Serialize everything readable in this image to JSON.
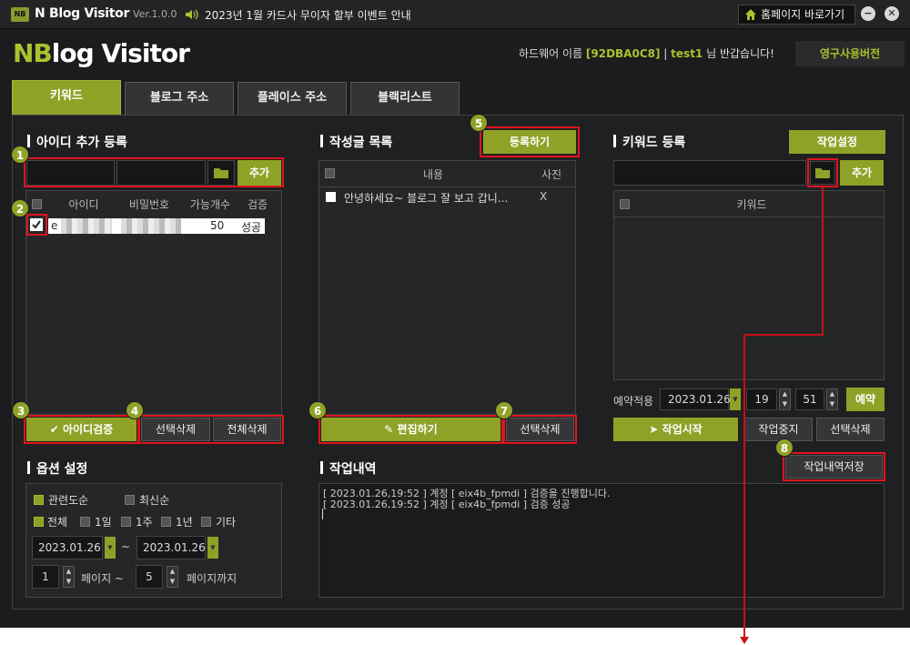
{
  "titlebar": {
    "logo_badge": "NB",
    "title": "N Blog Visitor",
    "version": "Ver.1.0.0",
    "notice": "2023년 1월 카드사 무이자 할부 이벤트 안내",
    "home_button": "홈페이지 바로가기",
    "minimize": "−",
    "close": "✕"
  },
  "header": {
    "logo_prefix": "NB",
    "logo_rest": "log Visitor",
    "greeting_prefix": "하드웨어 이름",
    "hardware_id": "[92DBA0C8]",
    "separator": "|",
    "username": "test1",
    "greeting_suffix": "님 반갑습니다!",
    "license": "영구사용버전"
  },
  "tabs": [
    {
      "label": "키워드"
    },
    {
      "label": "블로그 주소"
    },
    {
      "label": "플레이스 주소"
    },
    {
      "label": "블랙리스트"
    }
  ],
  "accounts": {
    "title": "아이디 추가 등록",
    "add_button": "추가",
    "columns": [
      "아이디",
      "비밀번호",
      "가능개수",
      "검증"
    ],
    "rows": [
      {
        "id_prefix": "e",
        "count": "50",
        "status": "성공"
      }
    ],
    "verify_button": "아이디검증",
    "delete_selected": "선택삭제",
    "delete_all": "전체삭제"
  },
  "posts": {
    "title": "작성글 목록",
    "register_button": "등록하기",
    "columns": [
      "내용",
      "사진"
    ],
    "rows": [
      {
        "content": "안녕하세요~ 블로그 잘 보고 갑니...",
        "photo": "X"
      }
    ],
    "edit_button": "편집하기",
    "delete_selected": "선택삭제"
  },
  "keywords": {
    "title": "키워드 등록",
    "settings_button": "작업설정",
    "add_button": "추가",
    "column": "키워드",
    "schedule_label": "예약적용",
    "date": "2023.01.26",
    "hour": "19",
    "minute": "51",
    "reserve_button": "예약",
    "start_button": "작업시작",
    "stop_button": "작업중지",
    "delete_selected": "선택삭제"
  },
  "options": {
    "title": "옵션 설정",
    "sort_relevance": "관련도순",
    "sort_recent": "최신순",
    "period": [
      "전체",
      "1일",
      "1주",
      "1년",
      "기타"
    ],
    "date_from": "2023.01.26",
    "tilde": "~",
    "date_to": "2023.01.26",
    "page_from": "1",
    "page_from_label": "페이지 ~",
    "page_to": "5",
    "page_to_label": "페이지까지"
  },
  "log": {
    "title": "작업내역",
    "save_button": "작업내역저장",
    "lines": [
      "[ 2023.01.26,19:52 ] 계정 [ eix4b_fpmdi ] 검증을 진행합니다.",
      "[ 2023.01.26,19:52 ] 계정 [ eix4b_fpmdi ] 검증 성공"
    ]
  },
  "callouts": [
    "1",
    "2",
    "3",
    "4",
    "5",
    "6",
    "7",
    "8"
  ],
  "colors": {
    "accent": "#8fa227",
    "highlight": "#e0141e",
    "background": "#1b1c1d"
  }
}
